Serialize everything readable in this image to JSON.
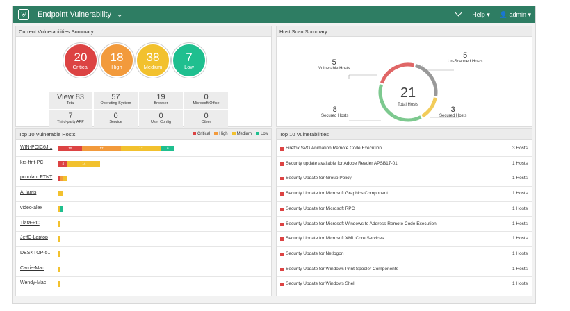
{
  "header": {
    "title": "Endpoint Vulnerability",
    "help_label": "Help",
    "user_label": "admin"
  },
  "summary": {
    "title": "Current Vulnerabilities Summary",
    "bubbles": [
      {
        "value": "20",
        "label": "Critical",
        "color": "#dc4343"
      },
      {
        "value": "18",
        "label": "High",
        "color": "#f29a3c"
      },
      {
        "value": "38",
        "label": "Medium",
        "color": "#f2c12e"
      },
      {
        "value": "7",
        "label": "Low",
        "color": "#1fbf8f"
      }
    ],
    "stats": [
      {
        "value": "View 83",
        "label": "Total"
      },
      {
        "value": "57",
        "label": "Operating System"
      },
      {
        "value": "19",
        "label": "Browser"
      },
      {
        "value": "0",
        "label": "Microsoft Office"
      },
      {
        "value": "7",
        "label": "Third-party APP"
      },
      {
        "value": "0",
        "label": "Service"
      },
      {
        "value": "0",
        "label": "User Config"
      },
      {
        "value": "0",
        "label": "Other"
      }
    ]
  },
  "hostscan": {
    "title": "Host Scan Summary",
    "total_value": "21",
    "total_label": "Total Hosts",
    "segments": [
      {
        "value": "5",
        "label": "Vulnerable Hosts",
        "color": "#e06666"
      },
      {
        "value": "5",
        "label": "Un-Scanned Hosts",
        "color": "#999999"
      },
      {
        "value": "3",
        "label": "Secured Hosts",
        "color": "#f2cc5a"
      },
      {
        "value": "8",
        "label": "Secured Hosts",
        "color": "#7dc98f"
      }
    ]
  },
  "hosts": {
    "title": "Top 10 Vulnerable Hosts",
    "legend": [
      {
        "label": "Critical",
        "color": "#dc4343"
      },
      {
        "label": "High",
        "color": "#f29a3c"
      },
      {
        "label": "Medium",
        "color": "#f2c12e"
      },
      {
        "label": "Low",
        "color": "#1fbf8f"
      }
    ],
    "rows": [
      {
        "name": "WIN-POIC6J...",
        "critical": 10,
        "high": 17,
        "medium": 17,
        "low": 6,
        "labels": [
          "10",
          "17",
          "17",
          "6"
        ]
      },
      {
        "name": "krs-ftnt-PC",
        "critical": 4,
        "high": 0,
        "medium": 14,
        "low": 0,
        "labels": [
          "4",
          "",
          "14",
          ""
        ]
      },
      {
        "name": "pconlan_FTNT",
        "critical": 1,
        "high": 1,
        "medium": 2,
        "low": 0,
        "labels": [
          "",
          "",
          "",
          ""
        ]
      },
      {
        "name": "AHarris",
        "critical": 0,
        "high": 0,
        "medium": 2,
        "low": 0,
        "labels": [
          "",
          "",
          "",
          ""
        ]
      },
      {
        "name": "video-alex",
        "critical": 0,
        "high": 0,
        "medium": 1,
        "low": 1,
        "labels": [
          "",
          "",
          "",
          ""
        ]
      },
      {
        "name": "Tiara-PC",
        "critical": 0,
        "high": 0,
        "medium": 0.6,
        "low": 0,
        "labels": [
          "",
          "",
          "",
          ""
        ]
      },
      {
        "name": "JeffC-Laptop",
        "critical": 0,
        "high": 0,
        "medium": 0.6,
        "low": 0,
        "labels": [
          "",
          "",
          "",
          ""
        ]
      },
      {
        "name": "DESKTOP-5...",
        "critical": 0,
        "high": 0,
        "medium": 0.6,
        "low": 0,
        "labels": [
          "",
          "",
          "",
          ""
        ]
      },
      {
        "name": "Carrie-Mac",
        "critical": 0,
        "high": 0,
        "medium": 0.6,
        "low": 0,
        "labels": [
          "",
          "",
          "",
          ""
        ]
      },
      {
        "name": "Wendy-Mac",
        "critical": 0,
        "high": 0,
        "medium": 0.6,
        "low": 0,
        "labels": [
          "",
          "",
          "",
          ""
        ]
      }
    ]
  },
  "vulns": {
    "title": "Top 10 Vulnerabilities",
    "rows": [
      {
        "name": "Firefox SVG Animation Remote Code Execution",
        "count": "3 Hosts"
      },
      {
        "name": "Security update available for Adobe Reader APSB17-01",
        "count": "1 Hosts"
      },
      {
        "name": "Security Update for Group Policy",
        "count": "1 Hosts"
      },
      {
        "name": "Security Update for Microsoft Graphics Component",
        "count": "1 Hosts"
      },
      {
        "name": "Security Update for Microsoft RPC",
        "count": "1 Hosts"
      },
      {
        "name": "Security Update for Microsoft Windows to Address Remote Code Execution",
        "count": "1 Hosts"
      },
      {
        "name": "Security Update for Microsoft XML Core Services",
        "count": "1 Hosts"
      },
      {
        "name": "Security Update for Netlogon",
        "count": "1 Hosts"
      },
      {
        "name": "Security Update for Windows Print Spooler Components",
        "count": "1 Hosts"
      },
      {
        "name": "Security Update for Windows Shell",
        "count": "1 Hosts"
      }
    ]
  }
}
